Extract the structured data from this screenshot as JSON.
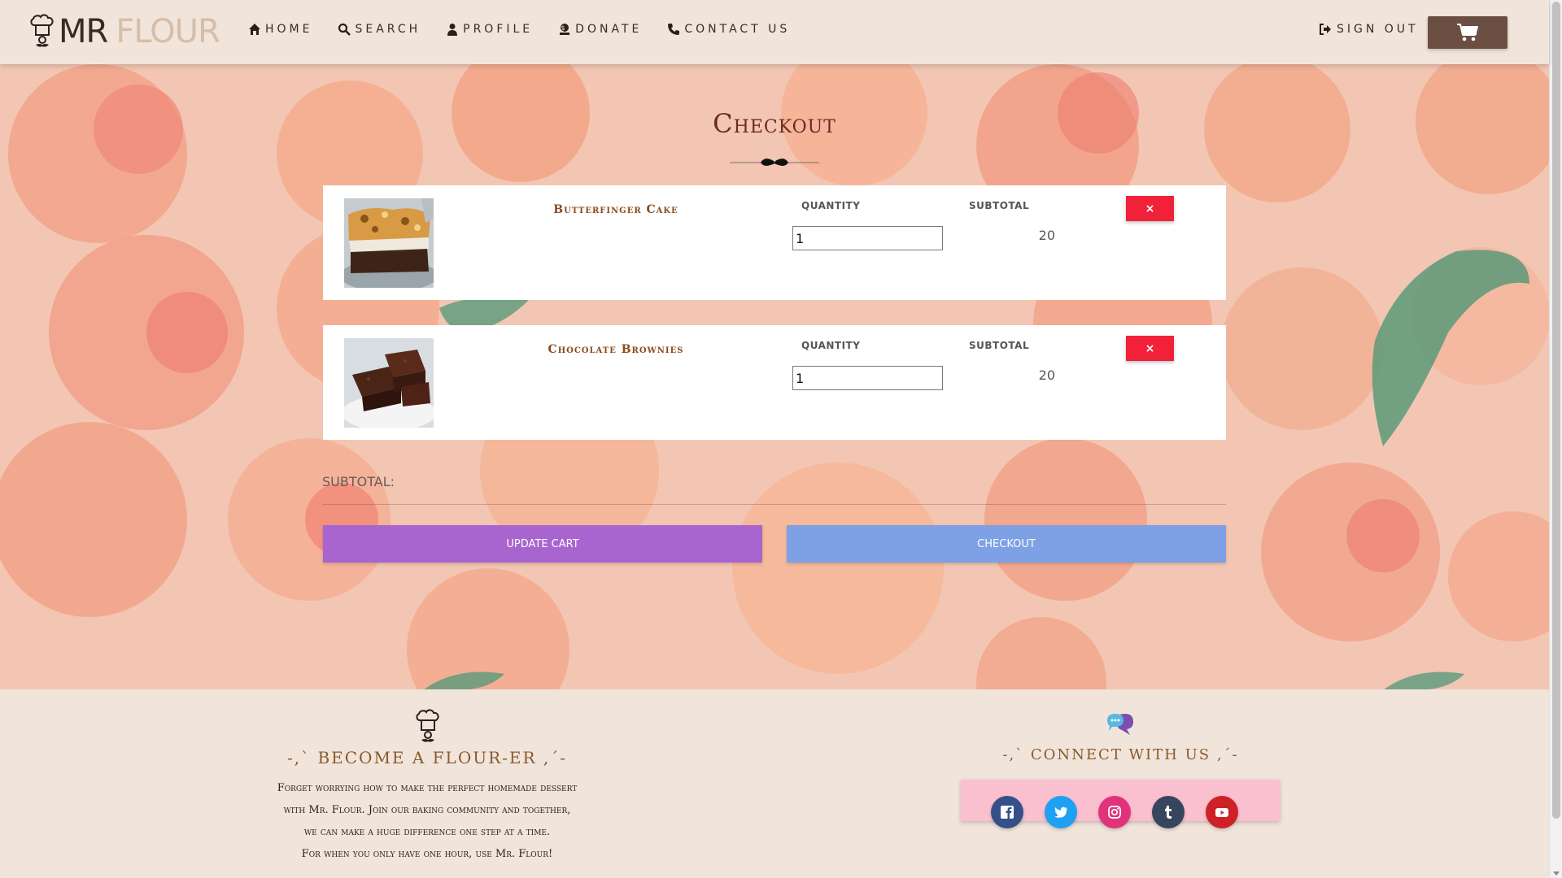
{
  "brand": {
    "mr": "MR",
    "flour": "FLOUR"
  },
  "nav": {
    "home": "HOME",
    "search": "SEARCH",
    "profile": "PROFILE",
    "donate": "DONATE",
    "contact": "CONTACT US",
    "signout": "SIGN OUT"
  },
  "checkout": {
    "title": "Checkout",
    "items": [
      {
        "name": "Butterfinger Cake",
        "quantity_header": "QUANTITY",
        "subtotal_header": "SUBTOTAL",
        "quantity": "1",
        "subtotal": "20",
        "remove": "×",
        "image_icon": "cake-image"
      },
      {
        "name": "Chocolate Brownies",
        "quantity_header": "QUANTITY",
        "subtotal_header": "SUBTOTAL",
        "quantity": "1",
        "subtotal": "20",
        "remove": "×",
        "image_icon": "brownies-image"
      }
    ],
    "subtotal_label": "SUBTOTAL:",
    "update_cart": "UPDATE CART",
    "checkout_button": "CHECKOUT"
  },
  "footer": {
    "become_title": "-,` BECOME A FLOUR-ER ,´-",
    "become_lines": [
      "Forget worrying how to make the perfect homemade dessert",
      "with Mr. Flour. Join our baking community and together,",
      "we can make a huge difference one step at a time.",
      "For when you only have one hour, use Mr. Flour!"
    ],
    "connect_title": "-,` CONNECT WITH US ,´-",
    "socials": [
      "facebook-icon",
      "twitter-icon",
      "instagram-icon",
      "tumblr-icon",
      "youtube-icon"
    ]
  },
  "colors": {
    "accent_brown": "#6b4e42",
    "update_purple": "#a865cf",
    "checkout_blue": "#7ea0e4",
    "remove_red": "#f2213a",
    "social_bar_pink": "#fbc0cf"
  }
}
